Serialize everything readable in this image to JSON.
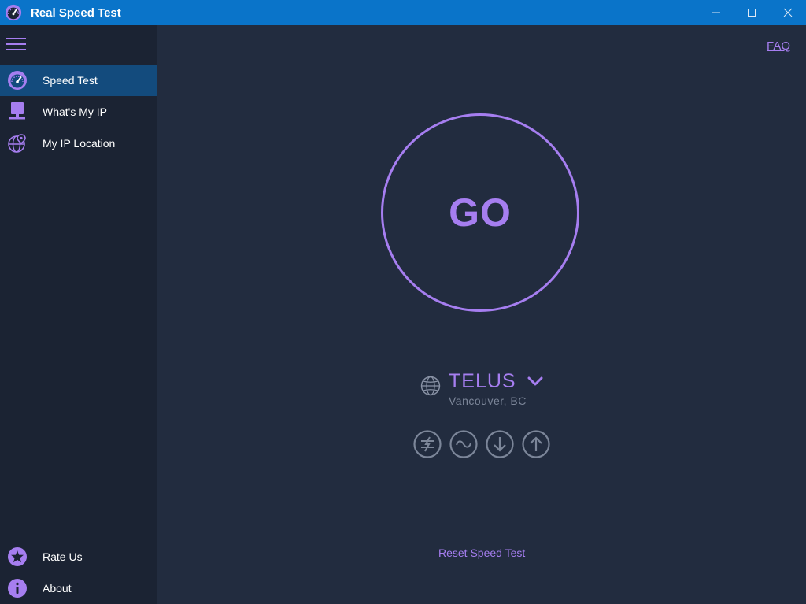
{
  "window": {
    "title": "Real Speed Test",
    "controls": {
      "minimize_icon": "minimize-icon",
      "maximize_icon": "maximize-icon",
      "close_icon": "close-icon"
    }
  },
  "sidebar": {
    "menu_icon": "hamburger-icon",
    "items": [
      {
        "label": "Speed Test",
        "icon": "speedometer-icon",
        "selected": true
      },
      {
        "label": "What's My IP",
        "icon": "network-computer-icon",
        "selected": false
      },
      {
        "label": "My IP Location",
        "icon": "globe-pin-icon",
        "selected": false
      }
    ],
    "footer_items": [
      {
        "label": "Rate Us",
        "icon": "star-icon"
      },
      {
        "label": "About",
        "icon": "info-icon"
      }
    ]
  },
  "main": {
    "faq_link": "FAQ",
    "go_label": "GO",
    "server": {
      "isp": "TELUS",
      "location": "Vancouver, BC"
    },
    "metrics": [
      {
        "icon": "ping-icon"
      },
      {
        "icon": "jitter-icon"
      },
      {
        "icon": "download-icon"
      },
      {
        "icon": "upload-icon"
      }
    ],
    "reset_link": "Reset Speed Test"
  },
  "colors": {
    "accent": "#a67ef0",
    "titlebar": "#0a74c9",
    "sidebar_bg": "#1b2333",
    "main_bg": "#222c3f",
    "selected_bg": "#134b7d",
    "muted": "#7c8699"
  }
}
